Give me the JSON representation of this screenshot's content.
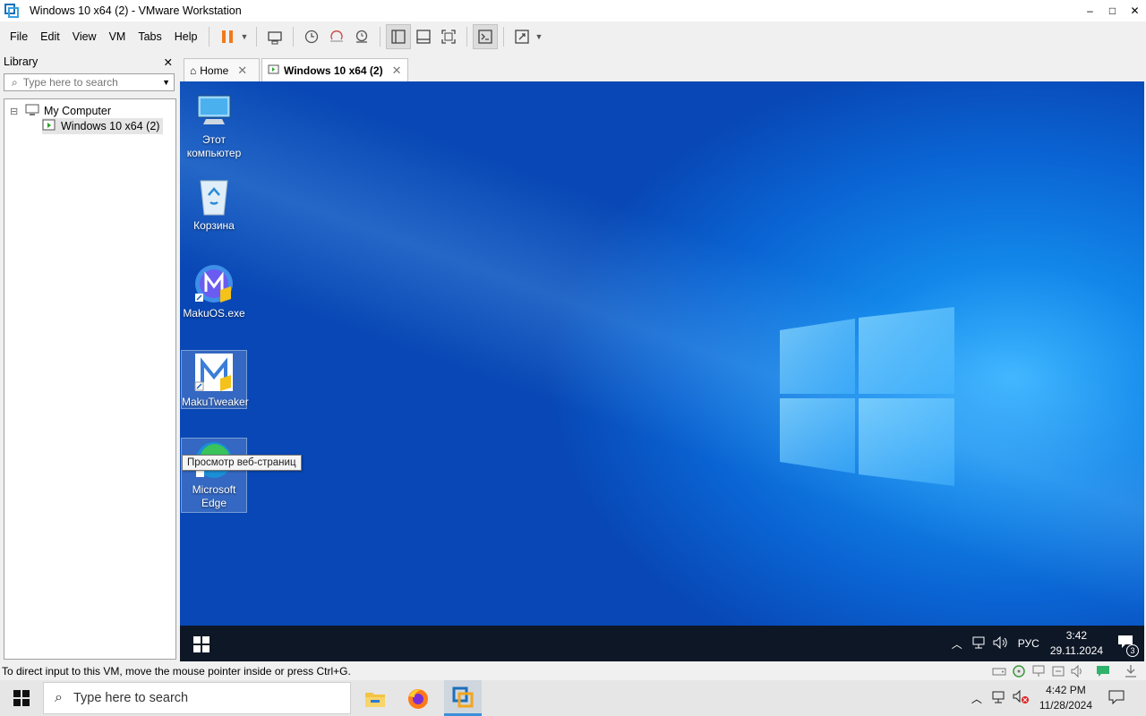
{
  "window": {
    "title": "Windows 10 x64 (2) - VMware Workstation",
    "controls": {
      "minimize": "–",
      "maximize": "□",
      "close": "✕"
    }
  },
  "menu": {
    "items": [
      "File",
      "Edit",
      "View",
      "VM",
      "Tabs",
      "Help"
    ]
  },
  "library": {
    "title": "Library",
    "close": "✕",
    "search_placeholder": "Type here to search",
    "tree": {
      "root_label": "My Computer",
      "root_expander": "⊟",
      "child_label": "Windows 10 x64 (2)"
    }
  },
  "tabs": [
    {
      "label": "Home",
      "close": "✕"
    },
    {
      "label": "Windows 10 x64 (2)",
      "close": "✕"
    }
  ],
  "guest": {
    "desktop_icons": [
      {
        "label": "Этот компьютер"
      },
      {
        "label": "Корзина"
      },
      {
        "label": "MakuOS.exe"
      },
      {
        "label": "MakuTweaker"
      },
      {
        "label": "Microsoft Edge"
      }
    ],
    "tooltip": "Просмотр веб-страниц",
    "taskbar": {
      "language": "РУС",
      "time": "3:42",
      "date": "29.11.2024",
      "notification_count": "3"
    }
  },
  "statusbar": {
    "message": "To direct input to this VM, move the mouse pointer inside or press Ctrl+G."
  },
  "host_taskbar": {
    "search_placeholder": "Type here to search",
    "time": "4:42 PM",
    "date": "11/28/2024"
  },
  "colors": {
    "desktop_accent": "#1287ea",
    "guest_taskbar": "#0e1726",
    "pause_button": "#f07a1a"
  }
}
